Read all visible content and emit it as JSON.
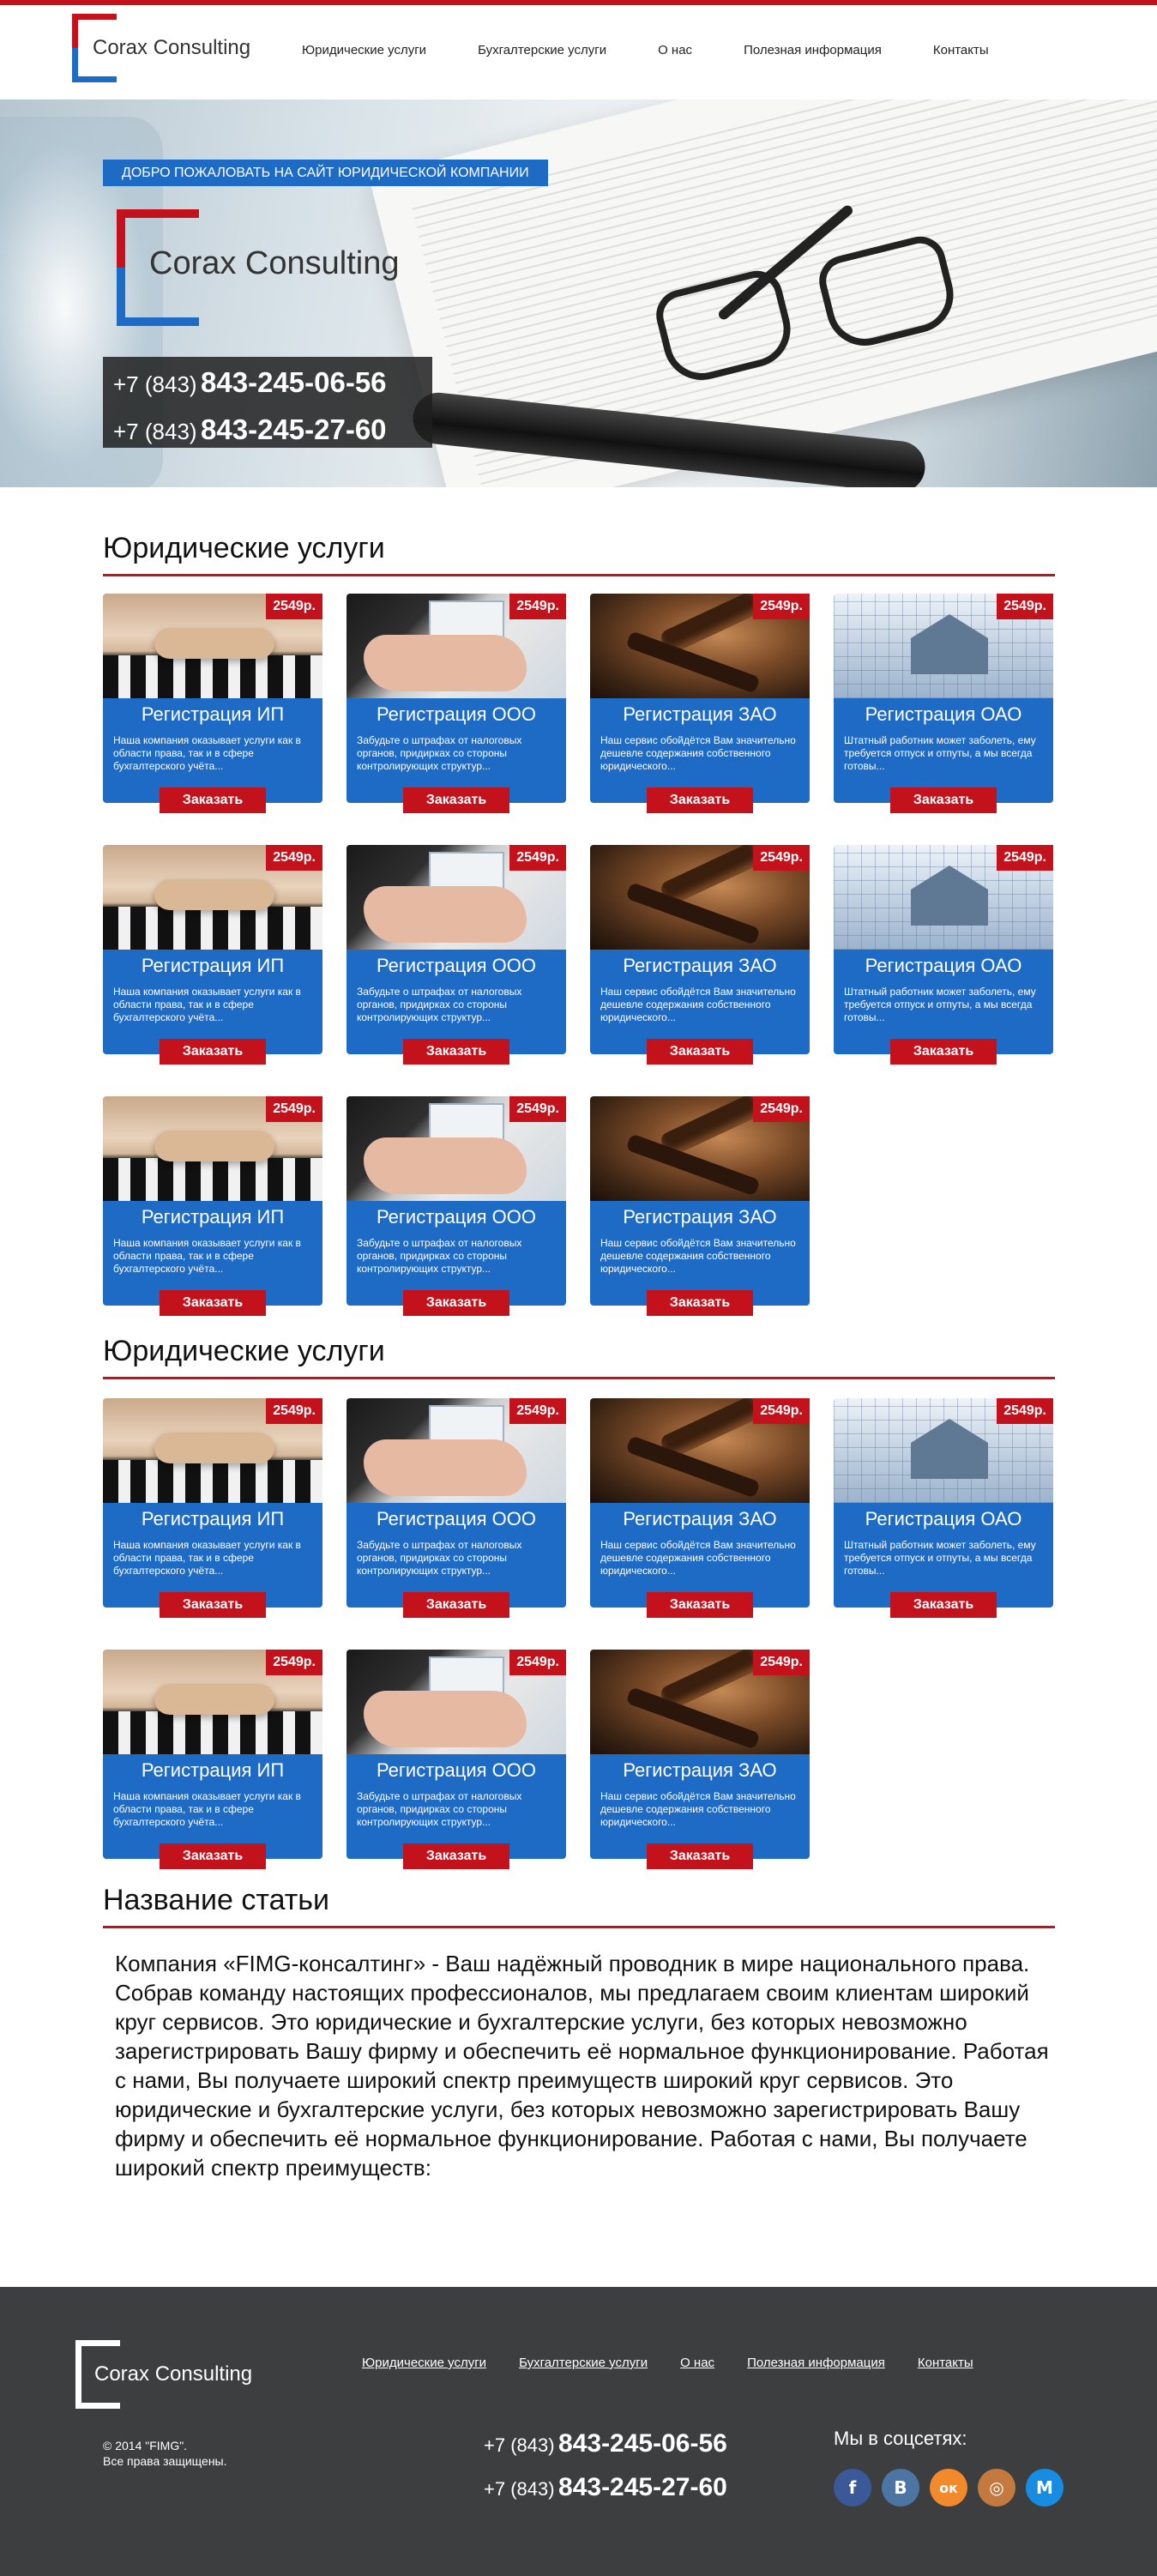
{
  "header": {
    "logo_text": "Corax Consulting",
    "nav": [
      "Юридические услуги",
      "Бухгалтерские услуги",
      "О нас",
      "Полезная информация",
      "Контакты"
    ]
  },
  "hero": {
    "welcome": "ДОБРО ПОЖАЛОВАТЬ НА САЙТ ЮРИДИЧЕСКОЙ КОМПАНИИ",
    "logo_text": "Corax Consulting",
    "phones": [
      {
        "code": "+7 (843)",
        "number": "843-245-06-56"
      },
      {
        "code": "+7 (843)",
        "number": "843-245-27-60"
      }
    ]
  },
  "services": {
    "ip": {
      "title": "Регистрация ИП",
      "desc": "Наша компания оказывает услуги как в области права, так и в сфере бухгалтерского учёта...",
      "price": "2549р.",
      "order": "Заказать"
    },
    "ooo": {
      "title": "Регистрация ООО",
      "desc": "Забудьте о штрафах от налоговых органов, придирках со стороны контролирующих структур...",
      "price": "2549р.",
      "order": "Заказать"
    },
    "zao": {
      "title": "Регистрация ЗАО",
      "desc": "Наш сервис обойдётся Вам значительно дешевле содержания собственного юридического...",
      "price": "2549р.",
      "order": "Заказать"
    },
    "oao": {
      "title": "Регистрация ОАО",
      "desc": "Штатный работник может заболеть, ему требуется отпуск и отпуты, а мы всегда готовы...",
      "price": "2549р.",
      "order": "Заказать"
    }
  },
  "sections": [
    {
      "title": "Юридические услуги"
    },
    {
      "title": "Юридические услуги"
    },
    {
      "title": "Название статьи"
    }
  ],
  "article": {
    "text": "Компания «FIMG-консалтинг» - Ваш надёжный проводник в мире национального права. Собрав команду настоящих профессионалов, мы предлагаем своим клиентам широкий круг сервисов. Это юридические и бухгалтерские услуги, без которых невозможно зарегистрировать Вашу фирму и обеспечить её нормальное функционирование. Работая с нами, Вы получаете широкий спектр преимуществ широкий круг сервисов. Это юридические и бухгалтерские услуги, без которых невозможно зарегистрировать Вашу фирму и обеспечить её нормальное функционирование. Работая с нами, Вы получаете широкий спектр преимуществ:"
  },
  "footer": {
    "logo_text": "Corax Consulting",
    "nav": [
      "Юридические услуги",
      "Бухгалтерские услуги",
      "О нас",
      "Полезная информация",
      "Контакты"
    ],
    "copyright_line1": "© 2014 \"FIMG\".",
    "copyright_line2": "Все права защищены.",
    "phones": [
      {
        "code": "+7 (843)",
        "number": "843-245-06-56"
      },
      {
        "code": "+7 (843)",
        "number": "843-245-27-60"
      }
    ],
    "social_label": "Мы в соцсетях:",
    "social": [
      {
        "name": "facebook-icon",
        "glyph": "f",
        "color": "#3b5998"
      },
      {
        "name": "vkontakte-icon",
        "glyph": "В",
        "color": "#4c75a3"
      },
      {
        "name": "odnoklassniki-icon",
        "glyph": "ок",
        "color": "#f2892b"
      },
      {
        "name": "instagram-icon",
        "glyph": "◎",
        "color": "#c47a3f"
      },
      {
        "name": "mailru-icon",
        "glyph": "M",
        "color": "#168de2"
      }
    ]
  },
  "colors": {
    "accent_red": "#c4121d",
    "accent_blue": "#1e6bc6",
    "footer_bg": "#3d3e40"
  }
}
